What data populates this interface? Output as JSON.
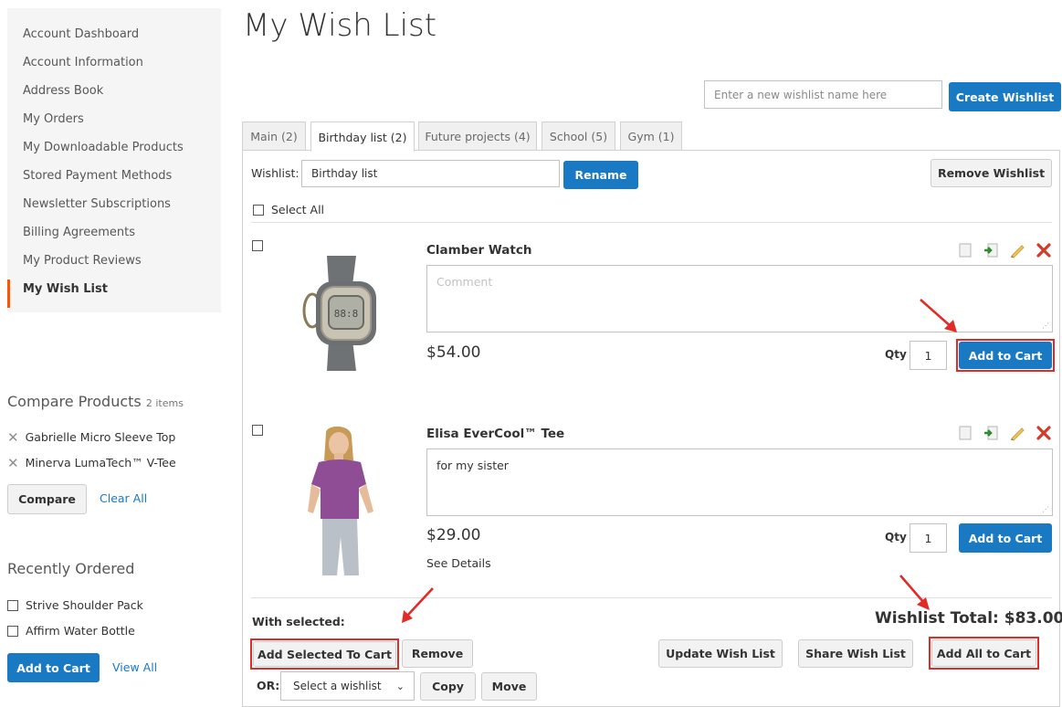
{
  "sidebar": {
    "items": [
      {
        "label": "Account Dashboard"
      },
      {
        "label": "Account Information"
      },
      {
        "label": "Address Book"
      },
      {
        "label": "My Orders"
      },
      {
        "label": "My Downloadable Products"
      },
      {
        "label": "Stored Payment Methods"
      },
      {
        "label": "Newsletter Subscriptions"
      },
      {
        "label": "Billing Agreements"
      },
      {
        "label": "My Product Reviews"
      },
      {
        "label": "My Wish List"
      }
    ]
  },
  "compare": {
    "title": "Compare Products",
    "count": "2 items",
    "items": [
      "Gabrielle Micro Sleeve Top",
      "Minerva LumaTech™ V-Tee"
    ],
    "compare_label": "Compare",
    "clear_label": "Clear All"
  },
  "recent": {
    "title": "Recently Ordered",
    "items": [
      "Strive Shoulder Pack",
      "Affirm Water Bottle"
    ],
    "add_label": "Add to Cart",
    "view_label": "View All"
  },
  "page": {
    "title": "My Wish List"
  },
  "create": {
    "placeholder": "Enter a new wishlist name here",
    "button": "Create Wishlist"
  },
  "tabs": [
    {
      "label": "Main (2)"
    },
    {
      "label": "Birthday list (2)"
    },
    {
      "label": "Future projects (4)"
    },
    {
      "label": "School (5)"
    },
    {
      "label": "Gym (1)"
    }
  ],
  "wishlist": {
    "name_label": "Wishlist:",
    "name_value": "Birthday list",
    "rename_label": "Rename",
    "remove_label": "Remove Wishlist",
    "select_all": "Select All"
  },
  "items": [
    {
      "name": "Clamber Watch",
      "comment_placeholder": "Comment",
      "comment": "",
      "price": "$54.00",
      "qty_label": "Qty",
      "qty": "1",
      "add_label": "Add to Cart",
      "details": ""
    },
    {
      "name": "Elisa EverCool™ Tee",
      "comment_placeholder": "",
      "comment": "for my sister",
      "price": "$29.00",
      "qty_label": "Qty",
      "qty": "1",
      "add_label": "Add to Cart",
      "details": "See Details"
    }
  ],
  "footer": {
    "with_selected": "With selected:",
    "total": "Wishlist Total: $83.00",
    "add_selected": "Add Selected To Cart",
    "remove": "Remove",
    "update": "Update Wish List",
    "share": "Share Wish List",
    "add_all": "Add All to Cart",
    "or_label": "OR:",
    "select_value": "Select a wishlist",
    "copy": "Copy",
    "move": "Move"
  },
  "colors": {
    "accent_blue": "#1979c3",
    "highlight_red": "#e02b27",
    "active_marker": "#ff5501",
    "sidebar_bg": "#f5f5f5"
  }
}
